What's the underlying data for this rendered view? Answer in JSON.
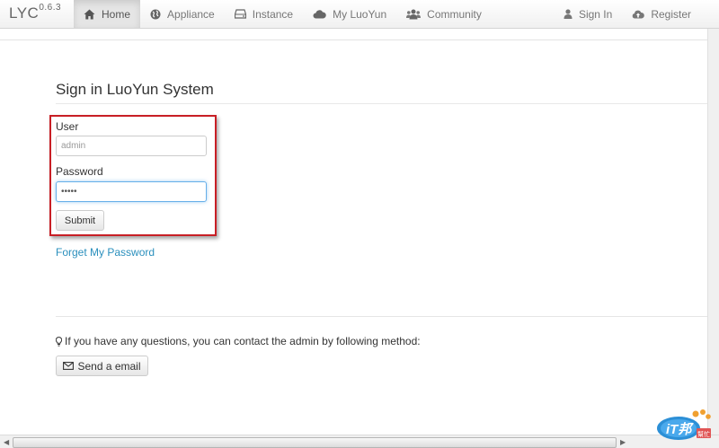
{
  "brand": {
    "name": "LYC",
    "version": "0.6.3"
  },
  "nav": {
    "left": [
      {
        "label": "Home",
        "icon": "home-icon",
        "active": true
      },
      {
        "label": "Appliance",
        "icon": "globe-icon"
      },
      {
        "label": "Instance",
        "icon": "hdd-icon"
      },
      {
        "label": "My LuoYun",
        "icon": "cloud-icon"
      },
      {
        "label": "Community",
        "icon": "group-icon"
      }
    ],
    "right": [
      {
        "label": "Sign In",
        "icon": "user-icon"
      },
      {
        "label": "Register",
        "icon": "cloud-upload-icon"
      }
    ]
  },
  "login": {
    "title": "Sign in LuoYun System",
    "user_label": "User",
    "user_value": "admin",
    "password_label": "Password",
    "password_value": "•••••",
    "submit_label": "Submit",
    "forgot_label": "Forget My Password"
  },
  "contact": {
    "text": "If you have any questions, you can contact the admin by following method:",
    "email_button": "Send a email"
  },
  "watermark": {
    "text": "iT邦幫忙"
  },
  "colors": {
    "highlight": "#c81f25",
    "link": "#2a8fbd"
  }
}
